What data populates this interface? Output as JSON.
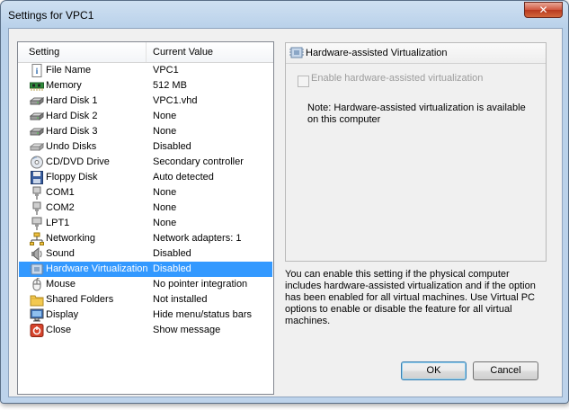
{
  "window": {
    "title": "Settings for VPC1",
    "close_glyph": "✕"
  },
  "list": {
    "headers": {
      "setting": "Setting",
      "value": "Current Value"
    },
    "items": [
      {
        "name": "File Name",
        "value": "VPC1",
        "icon": "file-info-icon"
      },
      {
        "name": "Memory",
        "value": "512 MB",
        "icon": "memory-chip-icon"
      },
      {
        "name": "Hard Disk 1",
        "value": "VPC1.vhd",
        "icon": "hard-disk-icon"
      },
      {
        "name": "Hard Disk 2",
        "value": "None",
        "icon": "hard-disk-icon"
      },
      {
        "name": "Hard Disk 3",
        "value": "None",
        "icon": "hard-disk-icon"
      },
      {
        "name": "Undo Disks",
        "value": "Disabled",
        "icon": "undo-disk-icon"
      },
      {
        "name": "CD/DVD Drive",
        "value": "Secondary controller",
        "icon": "cd-dvd-icon"
      },
      {
        "name": "Floppy Disk",
        "value": "Auto detected",
        "icon": "floppy-disk-icon"
      },
      {
        "name": "COM1",
        "value": "None",
        "icon": "com-port-icon"
      },
      {
        "name": "COM2",
        "value": "None",
        "icon": "com-port-icon"
      },
      {
        "name": "LPT1",
        "value": "None",
        "icon": "lpt-port-icon"
      },
      {
        "name": "Networking",
        "value": "Network adapters: 1",
        "icon": "network-icon"
      },
      {
        "name": "Sound",
        "value": "Disabled",
        "icon": "sound-icon"
      },
      {
        "name": "Hardware Virtualization",
        "value": "Disabled",
        "icon": "hardware-virtualization-icon"
      },
      {
        "name": "Mouse",
        "value": "No pointer integration",
        "icon": "mouse-icon"
      },
      {
        "name": "Shared Folders",
        "value": "Not installed",
        "icon": "folder-icon"
      },
      {
        "name": "Display",
        "value": "Hide menu/status bars",
        "icon": "display-icon"
      },
      {
        "name": "Close",
        "value": "Show message",
        "icon": "close-power-icon"
      }
    ],
    "selected_index": 13,
    "colors": {
      "selection": "#3399ff"
    }
  },
  "panel": {
    "title": "Hardware-assisted Virtualization",
    "checkbox_label": "Enable hardware-assisted virtualization",
    "checkbox_checked": false,
    "note": "Note: Hardware-assisted virtualization is available on this computer"
  },
  "description": "You can enable this setting if the physical computer includes hardware-assisted virtualization and if the option has been enabled for all virtual machines. Use Virtual PC options to enable or disable the feature for all virtual machines.",
  "buttons": {
    "ok": "OK",
    "cancel": "Cancel"
  }
}
